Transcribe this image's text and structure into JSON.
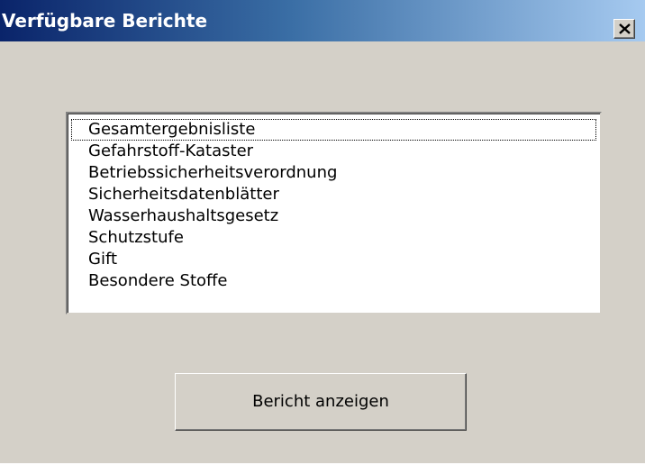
{
  "window": {
    "title": "Verfügbare Berichte",
    "close_icon": "close-icon"
  },
  "report_list": {
    "items": [
      "Gesamtergebnisliste",
      "Gefahrstoff-Kataster",
      "Betriebssicherheitsverordnung",
      "Sicherheitsdatenblätter",
      "Wasserhaushaltsgesetz",
      "Schutzstufe",
      "Gift",
      "Besondere Stoffe"
    ],
    "focused_index": 0
  },
  "actions": {
    "show_report_label": "Bericht anzeigen"
  },
  "colors": {
    "titlebar_start": "#0a246a",
    "titlebar_end": "#a6caf0",
    "face": "#d4d0c8"
  }
}
